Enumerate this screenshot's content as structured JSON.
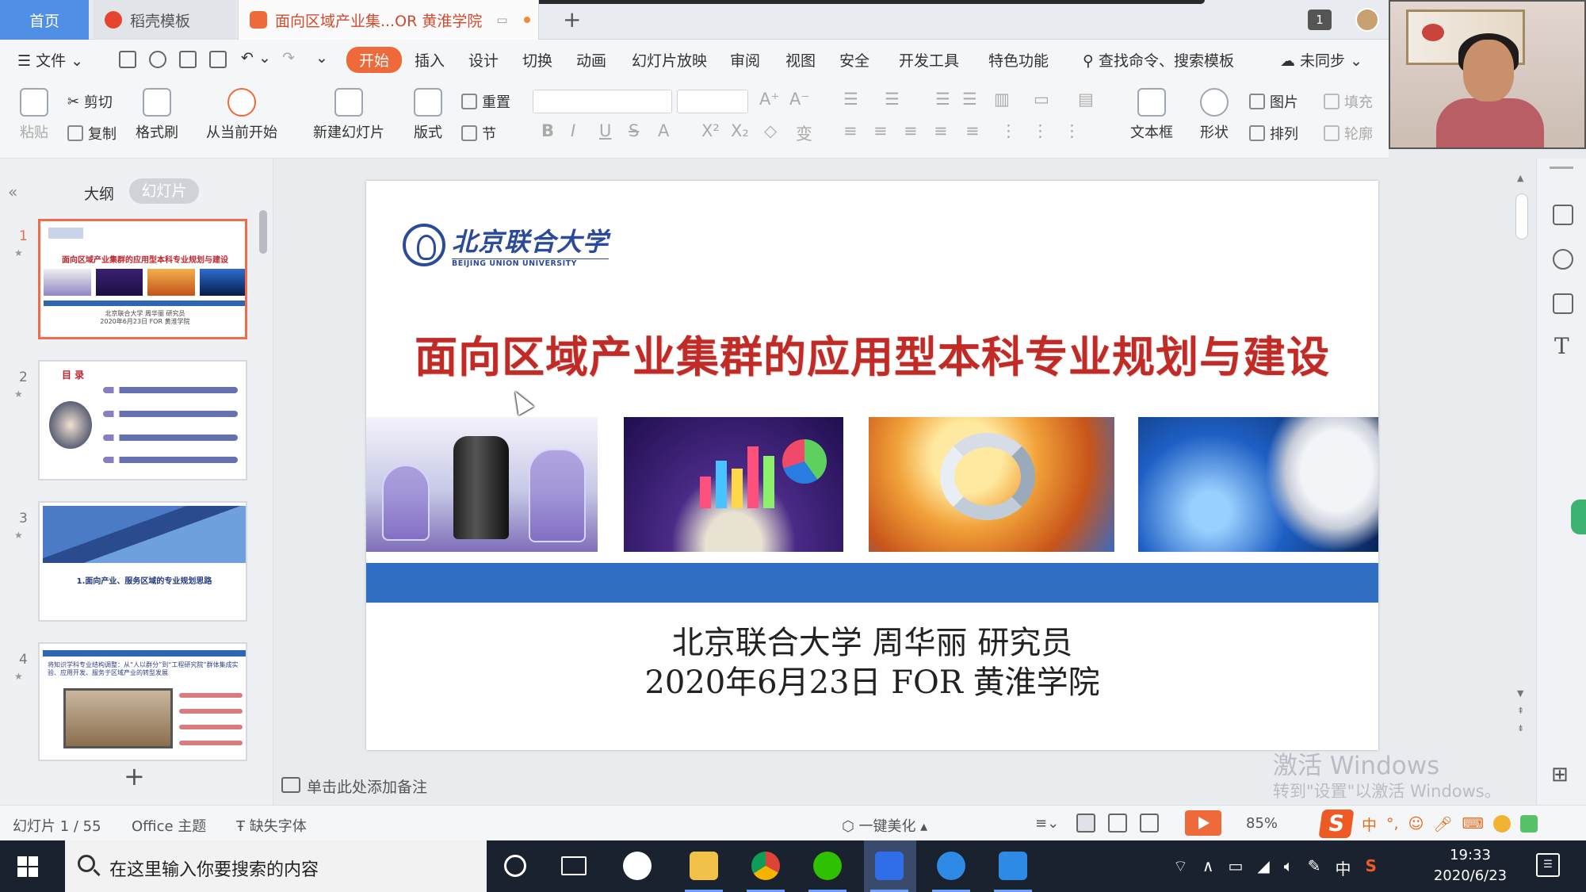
{
  "tabs": {
    "home": "首页",
    "template": "稻壳模板",
    "document": "面向区域产业集...OR 黄淮学院"
  },
  "window": {
    "count_badge": "1"
  },
  "menu": {
    "file": "文件",
    "items": [
      "开始",
      "插入",
      "设计",
      "切换",
      "动画",
      "幻灯片放映",
      "审阅",
      "视图",
      "安全",
      "开发工具",
      "特色功能"
    ],
    "search": "查找命令、搜索模板",
    "sync": "未同步"
  },
  "ribbon": {
    "paste": "粘贴",
    "cut": "剪切",
    "copy": "复制",
    "format_painter": "格式刷",
    "from_current": "从当前开始",
    "new_slide": "新建幻灯片",
    "layout": "版式",
    "reset": "重置",
    "section": "节",
    "text_box": "文本框",
    "shape": "形状",
    "picture": "图片",
    "fill": "填充",
    "arrange": "排列",
    "outline": "轮廓"
  },
  "panel": {
    "outline_tab": "大纲",
    "slides_tab": "幻灯片",
    "thumbs": [
      {
        "num": "1",
        "title": "面向区域产业集群的应用型本科专业规划与建设",
        "foot1": "北京联合大学 周华丽 研究员",
        "foot2": "2020年6月23日 FOR 黄淮学院"
      },
      {
        "num": "2",
        "title": "目 录"
      },
      {
        "num": "3",
        "caption": "1.面向产业、服务区域的专业规划思路"
      },
      {
        "num": "4",
        "caption": "将知识学科专业结构调整：从“人以群分”到“工程研究院”群体集成实验、应用开发、服务于区域产业的转型发展"
      }
    ]
  },
  "slide": {
    "logo_cn": "北京联合大学",
    "logo_en": "BEIJING UNION UNIVERSITY",
    "title": "面向区域产业集群的应用型本科专业规划与建设",
    "author": "北京联合大学 周华丽 研究员",
    "date": "2020年6月23日 FOR 黄淮学院",
    "band_color": "#2f6ec1",
    "title_color": "#c22a26"
  },
  "notes": {
    "placeholder": "单击此处添加备注"
  },
  "watermark": {
    "line1": "激活 Windows",
    "line2": "转到\"设置\"以激活 Windows。"
  },
  "status": {
    "slide_count": "幻灯片 1 / 55",
    "theme": "Office 主题",
    "missing_font": "缺失字体",
    "beautify": "一键美化",
    "zoom": "85%",
    "ime_lang": "中"
  },
  "taskbar": {
    "search_placeholder": "在这里输入你要搜索的内容",
    "ime": "中",
    "time": "19:33",
    "date": "2020/6/23"
  }
}
